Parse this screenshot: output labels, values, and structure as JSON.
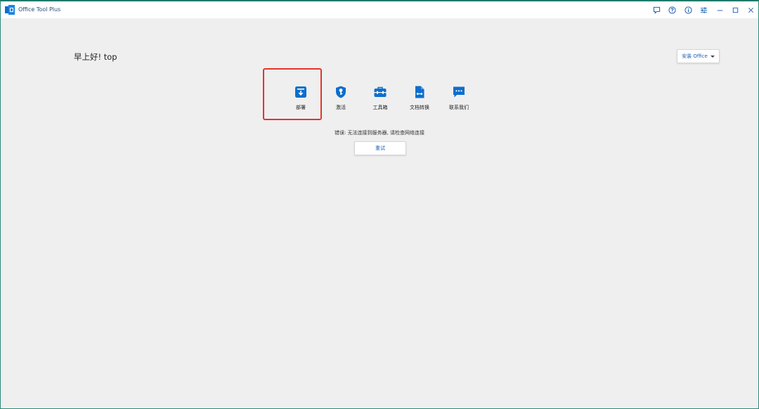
{
  "window": {
    "title": "Office Tool Plus",
    "accent_color": "#0e6ecb",
    "border_color": "#2b8a7a"
  },
  "titlebar": {
    "buttons": [
      {
        "name": "feedback-icon"
      },
      {
        "name": "help-icon"
      },
      {
        "name": "info-icon"
      },
      {
        "name": "settings-icon"
      },
      {
        "name": "minimize-icon"
      },
      {
        "name": "maximize-icon"
      },
      {
        "name": "close-icon"
      }
    ]
  },
  "main": {
    "greeting": "早上好! top",
    "install_button": {
      "label": "安装 Office"
    },
    "features": [
      {
        "label": "部署",
        "icon": "deploy-icon"
      },
      {
        "label": "激活",
        "icon": "activate-shield-icon"
      },
      {
        "label": "工具箱",
        "icon": "toolbox-icon"
      },
      {
        "label": "文档转换",
        "icon": "document-convert-icon"
      },
      {
        "label": "联系我们",
        "icon": "chat-bubble-icon"
      }
    ],
    "highlight_color": "#e8322a",
    "error_message": "错误: 无法连接到服务器, 请检查网络连接",
    "retry_label": "重试"
  }
}
